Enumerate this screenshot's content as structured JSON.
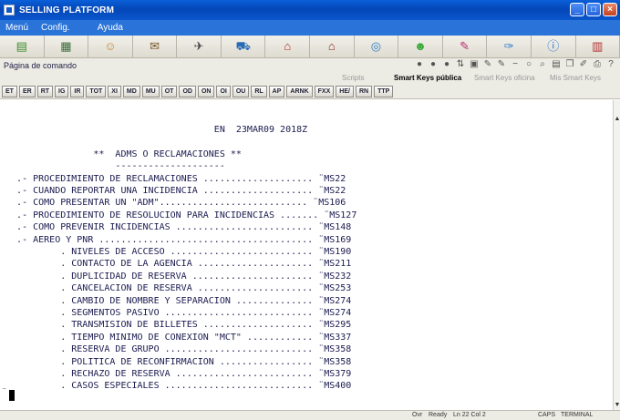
{
  "window": {
    "title": "SELLING PLATFORM"
  },
  "menu": [
    "Menú",
    "Config.",
    "Ayuda"
  ],
  "toolbar_icons": [
    {
      "name": "book-icon",
      "glyph": "▤",
      "color": "#3a8d2b"
    },
    {
      "name": "queue-icon",
      "glyph": "▦",
      "color": "#3b6b3a"
    },
    {
      "name": "person-icon",
      "glyph": "☺",
      "color": "#c08a30"
    },
    {
      "name": "suitcase-icon",
      "glyph": "✉",
      "color": "#7a5a2a"
    },
    {
      "name": "airplane-icon",
      "glyph": "✈",
      "color": "#444"
    },
    {
      "name": "car-icon",
      "glyph": "⛟",
      "color": "#2a6bb8"
    },
    {
      "name": "hotel-icon",
      "glyph": "⌂",
      "color": "#b42828"
    },
    {
      "name": "hotel2-icon",
      "glyph": "⌂",
      "color": "#8a1c1c"
    },
    {
      "name": "globe-icon",
      "glyph": "◎",
      "color": "#2b7dc7"
    },
    {
      "name": "emoticon-icon",
      "glyph": "☻",
      "color": "#38a838"
    },
    {
      "name": "pencil-icon",
      "glyph": "✎",
      "color": "#b4306e"
    },
    {
      "name": "scroll-icon",
      "glyph": "✑",
      "color": "#2a7ad0"
    },
    {
      "name": "info-icon",
      "glyph": "ⓘ",
      "color": "#1f6bd0"
    },
    {
      "name": "bank-icon",
      "glyph": "▥",
      "color": "#b03030"
    }
  ],
  "command": {
    "label": "Página de comando"
  },
  "tabs": {
    "scripts": "Scripts",
    "public": "Smart Keys pública",
    "office": "Smart Keys oficina",
    "mine": "Mis Smart Keys"
  },
  "function_keys": [
    "ET",
    "ER",
    "RT",
    "IG",
    "IR",
    "TOT",
    "XI",
    "MD",
    "MU",
    "OT",
    "OD",
    "ON",
    "OI",
    "OU",
    "RL",
    "AP",
    "ARNK",
    "FXX",
    "HE/",
    "RN",
    "TTP"
  ],
  "terminal": {
    "lines": [
      "                                       EN  23MAR09 2018Z",
      "",
      "                 **  ADMS O RECLAMACIONES **",
      "                     --------------------",
      "   .- PROCEDIMIENTO DE RECLAMACIONES .................... ¨MS22",
      "   .- CUANDO REPORTAR UNA INCIDENCIA .................... ¨MS22",
      "   .- COMO PRESENTAR UN \"ADM\"........................... ¨MS106",
      "   .- PROCEDIMIENTO DE RESOLUCION PARA INCIDENCIAS ....... ¨MS127",
      "   .- COMO PREVENIR INCIDENCIAS ......................... ¨MS148",
      "   .- AEREO Y PNR ....................................... ¨MS169",
      "           . NIVELES DE ACCESO .......................... ¨MS190",
      "           . CONTACTO DE LA AGENCIA ..................... ¨MS211",
      "           . DUPLICIDAD DE RESERVA ...................... ¨MS232",
      "           . CANCELACION DE RESERVA ..................... ¨MS253",
      "           . CAMBIO DE NOMBRE Y SEPARACION .............. ¨MS274",
      "           . SEGMENTOS PASIVO ........................... ¨MS274",
      "           . TRANSMISION DE BILLETES .................... ¨MS295",
      "           . TIEMPO MINIMO DE CONEXION \"MCT\" ............ ¨MS337",
      "           . RESERVA DE GRUPO ........................... ¨MS358",
      "           . POLITICA DE RECONFIRMACION ................. ¨MS358",
      "           . RECHAZO DE RESERVA ......................... ¨MS379",
      "           . CASOS ESPECIALES ........................... ¨MS400"
    ],
    "prompt": "¨"
  },
  "status": {
    "mode": "Ovr",
    "ready": "Ready",
    "position": "Ln 22 Col 2",
    "caps": "CAPS",
    "terminal": "TERMINAL"
  }
}
